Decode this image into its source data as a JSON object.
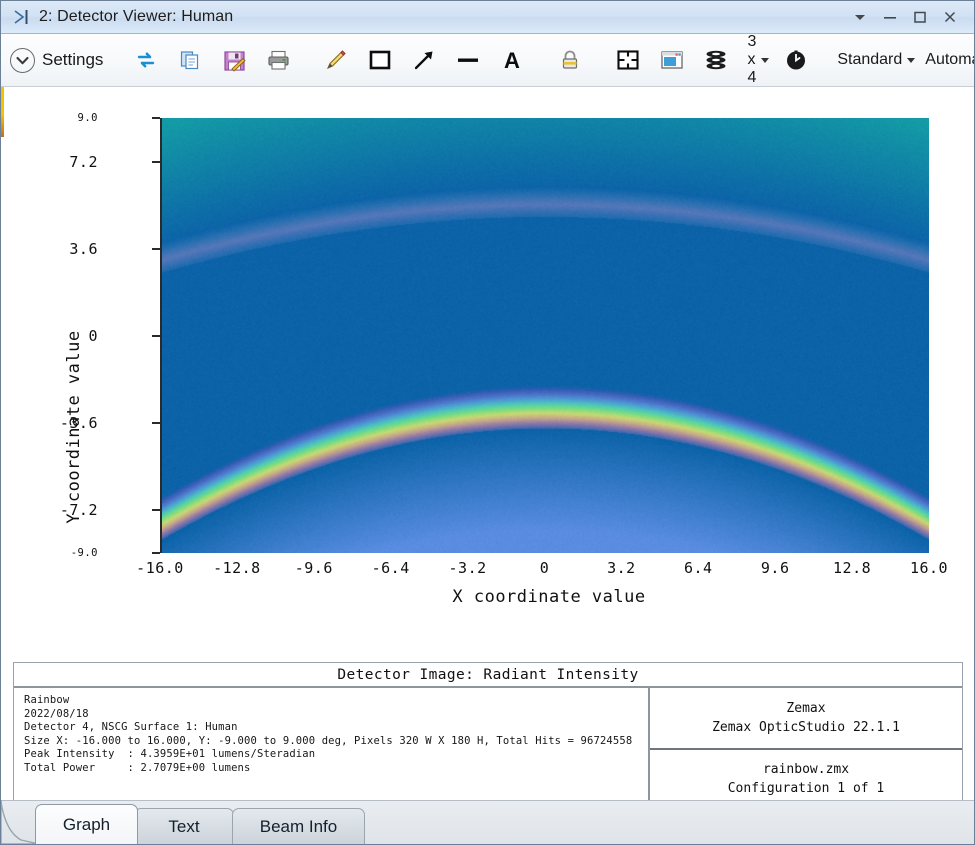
{
  "window": {
    "title": "2: Detector Viewer: Human",
    "app_icon": "detector-viewer-icon",
    "controls": {
      "dropdown": "▾",
      "minimize": "–",
      "maximize": "□",
      "close": "✕"
    }
  },
  "toolbar": {
    "settings_label": "Settings",
    "icons": [
      {
        "name": "refresh-icon",
        "title": "Update"
      },
      {
        "name": "copy-icon",
        "title": "Copy"
      },
      {
        "name": "save-icon",
        "title": "Save"
      },
      {
        "name": "print-icon",
        "title": "Print"
      },
      {
        "name": "annotate-pencil-icon",
        "title": "Draw"
      },
      {
        "name": "rectangle-icon",
        "title": "Rectangle"
      },
      {
        "name": "arrow-icon",
        "title": "Arrow"
      },
      {
        "name": "line-icon",
        "title": "Line"
      },
      {
        "name": "text-icon",
        "title": "Text"
      },
      {
        "name": "lock-icon",
        "title": "Lock"
      },
      {
        "name": "grid-icon",
        "title": "Tile"
      },
      {
        "name": "window-icon",
        "title": "Windows"
      },
      {
        "name": "layers-icon",
        "title": "Layers"
      }
    ],
    "aspect_label": "3 x 4",
    "reset_icon": "reset-icon",
    "style_dropdown": "Standard",
    "scale_dropdown": "Automatic",
    "help_icon": "help-icon"
  },
  "chart_data": {
    "type": "heatmap",
    "title": "Detector Image: Radiant Intensity",
    "xlabel": "X coordinate value",
    "ylabel": "Y coordinate value",
    "xlim": [
      -16.0,
      16.0
    ],
    "ylim": [
      -9.0,
      9.0
    ],
    "xticks": [
      "-16.0",
      "-12.8",
      "-9.6",
      "-6.4",
      "-3.2",
      "0",
      "3.2",
      "6.4",
      "9.6",
      "12.8",
      "16.0"
    ],
    "xtick_values": [
      -16.0,
      -12.8,
      -9.6,
      -6.4,
      -3.2,
      0,
      3.2,
      6.4,
      9.6,
      12.8,
      16.0
    ],
    "yticks": [
      "9.0",
      "7.2",
      "3.6",
      "0",
      "-3.6",
      "-7.2",
      "-9.0"
    ],
    "ytick_values": [
      9.0,
      7.2,
      3.6,
      0,
      -3.6,
      -7.2,
      -9.0
    ],
    "grid": false,
    "legend": "none",
    "background_color": "#0b63a8",
    "description": "Rainbow detector image: a bright primary rainbow arc peaking near Y = -3.0 deg and a fainter secondary arc peaking near Y = 5.4 deg over a blue sky background.",
    "arcs": [
      {
        "name": "primary-bow",
        "peak_y": -3.0,
        "edge_y_at_xmax": -7.6,
        "band_order_top_to_bottom": [
          "violet",
          "blue",
          "green",
          "yellow",
          "red"
        ],
        "intensity": "bright"
      },
      {
        "name": "secondary-bow",
        "peak_y": 5.4,
        "edge_y_at_xmax": 3.1,
        "band_order_top_to_bottom": [
          "red",
          "yellow",
          "green",
          "violet"
        ],
        "intensity": "faint"
      }
    ]
  },
  "info": {
    "header": "Detector Image: Radiant Intensity",
    "lines": [
      "Rainbow",
      "2022/08/18",
      "Detector 4, NSCG Surface 1: Human",
      "Size X: -16.000 to 16.000, Y: -9.000 to 9.000 deg, Pixels 320 W X 180 H, Total Hits = 96724558",
      "Peak Intensity  : 4.3959E+01 lumens/Steradian",
      "Total Power     : 2.7079E+00 lumens"
    ],
    "vendor": "Zemax",
    "product": "Zemax OpticStudio 22.1.1",
    "file": "rainbow.zmx",
    "configuration": "Configuration 1 of 1"
  },
  "tabs": [
    {
      "label": "Graph",
      "active": true
    },
    {
      "label": "Text",
      "active": false
    },
    {
      "label": "Beam Info",
      "active": false
    }
  ]
}
